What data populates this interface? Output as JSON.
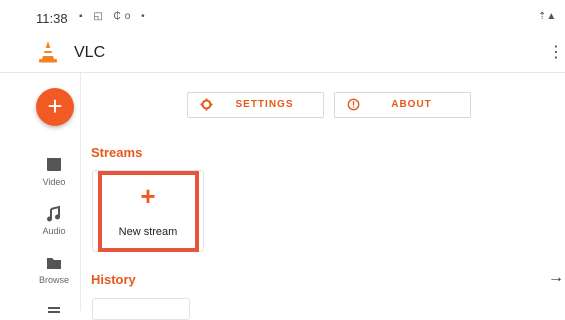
{
  "status_bar": {
    "time": "11:38",
    "left_icons": "▪ ◱ ₵o •",
    "right_icons": "⇡▲"
  },
  "app": {
    "title": "VLC",
    "more_icon": "⋮"
  },
  "colors": {
    "accent": "#f15a22",
    "highlight": "#e9553a"
  },
  "fab": {
    "symbol": "+"
  },
  "nav_rail": {
    "items": [
      {
        "label": "Video",
        "icon": "movie-icon"
      },
      {
        "label": "Audio",
        "icon": "music-note-icon"
      },
      {
        "label": "Browse",
        "icon": "folder-icon"
      },
      {
        "label": "",
        "icon": "menu-icon"
      }
    ]
  },
  "buttons": {
    "settings": "SETTINGS",
    "about": "ABOUT"
  },
  "streams": {
    "title": "Streams",
    "new_stream_label": "New stream",
    "new_stream_symbol": "+"
  },
  "history": {
    "title": "History",
    "arrow": "→"
  }
}
